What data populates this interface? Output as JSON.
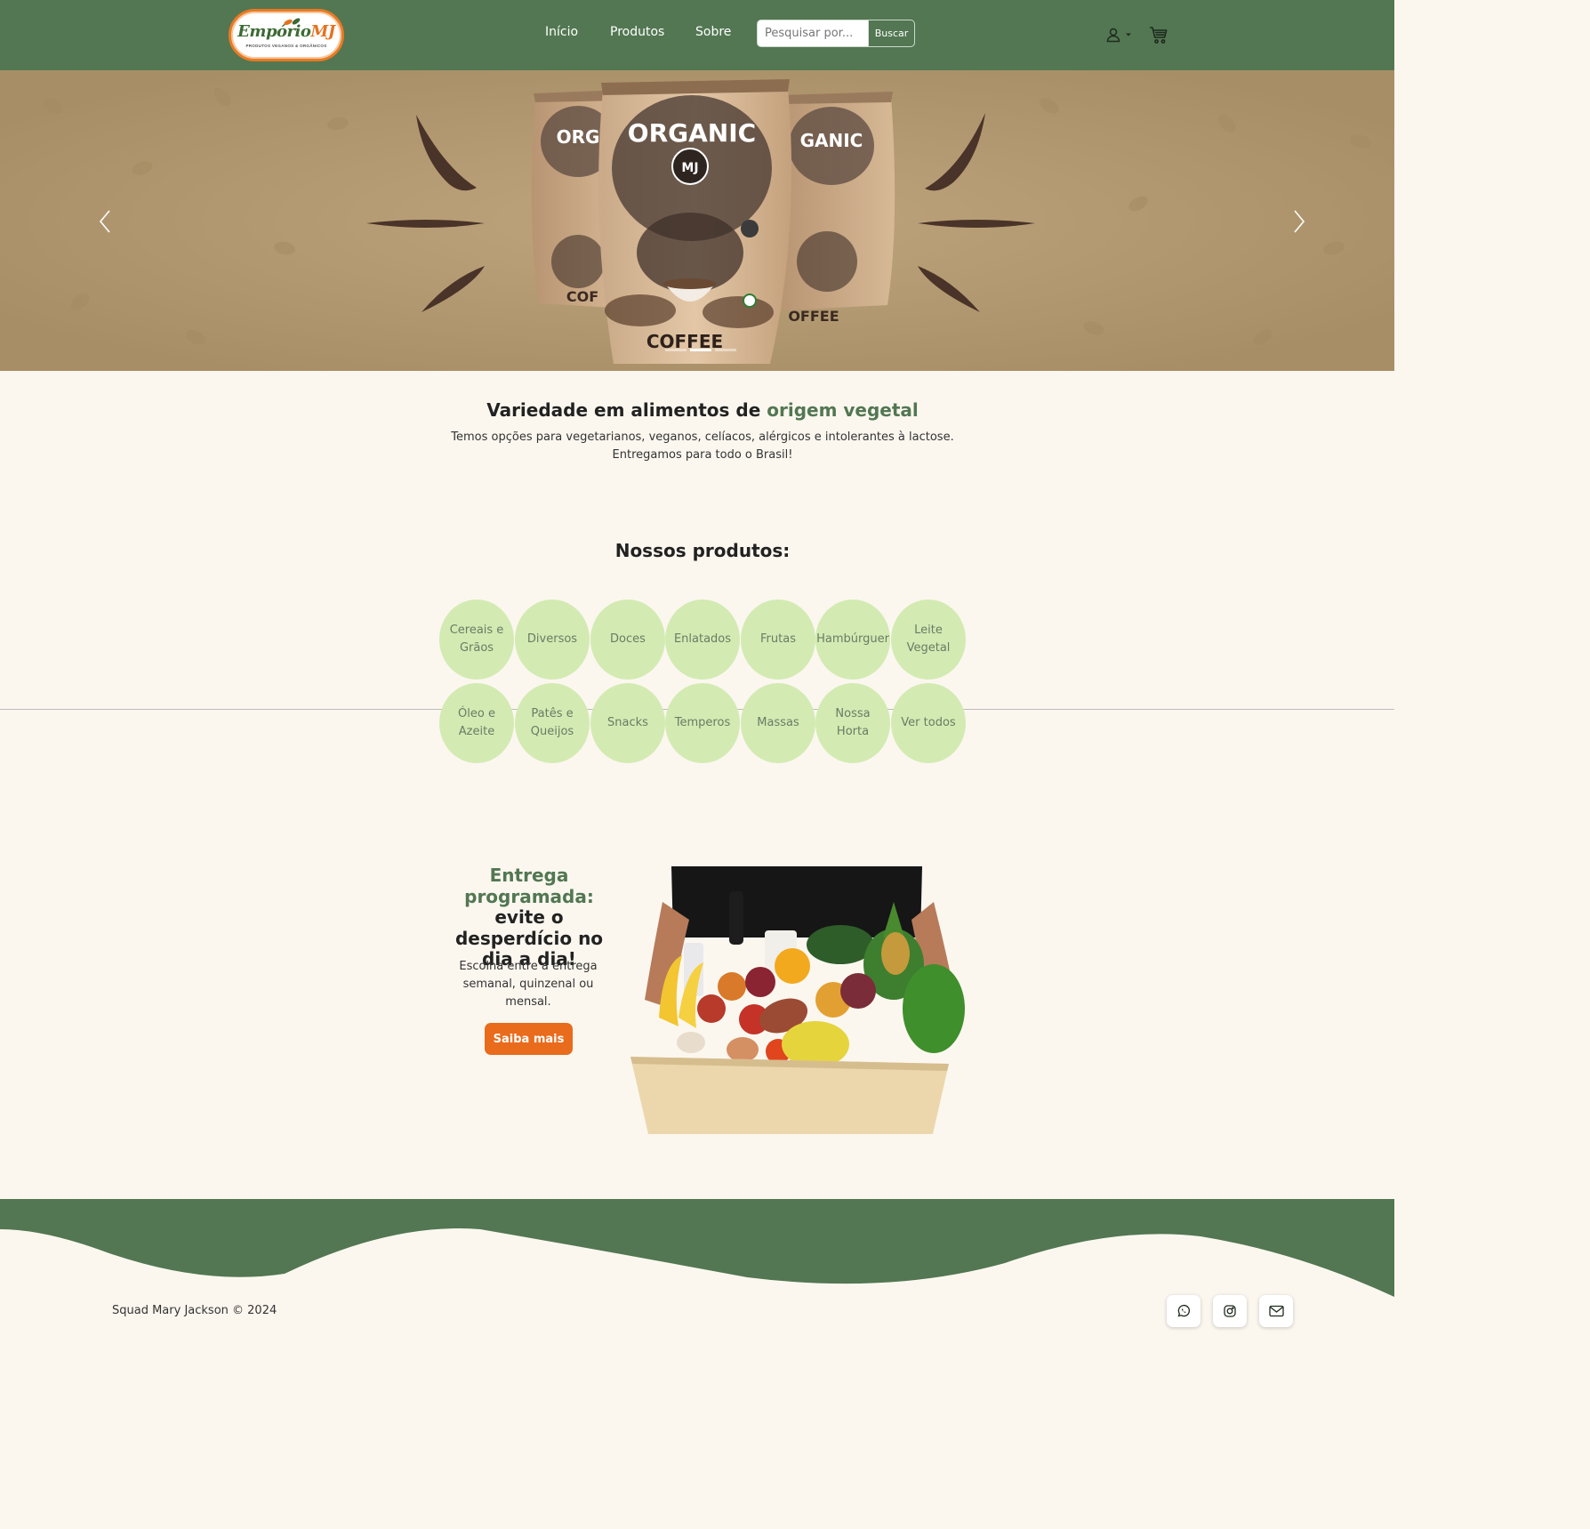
{
  "header": {
    "logo": {
      "name_part1": "Empório",
      "name_part2": "MJ",
      "tagline": "PRODUTOS VEGANOS & ORGÂNICOS"
    },
    "nav": [
      {
        "label": "Início"
      },
      {
        "label": "Produtos"
      },
      {
        "label": "Sobre"
      }
    ],
    "search": {
      "placeholder": "Pesquisar por...",
      "button_label": "Buscar"
    },
    "icons": {
      "user": "user-icon",
      "user_dropdown": "caret-down-icon",
      "cart": "cart-icon"
    }
  },
  "hero": {
    "bag_title": "ORGANIC",
    "bag_subtitle": "COFFEE",
    "bag_badge": "MJ",
    "icons": {
      "prev": "chevron-left-icon",
      "next": "chevron-right-icon"
    },
    "slide_count": 3,
    "active_slide": 2
  },
  "intro": {
    "title_main": "Variedade em alimentos de ",
    "title_accent": "origem vegetal",
    "line1": "Temos opções para vegetarianos, veganos, celíacos, alérgicos e intolerantes à lactose.",
    "line2": "Entregamos para todo o Brasil!"
  },
  "products": {
    "title": "Nossos produtos:",
    "categories": [
      {
        "label": "Cereais e Grãos"
      },
      {
        "label": "Diversos"
      },
      {
        "label": "Doces"
      },
      {
        "label": "Enlatados"
      },
      {
        "label": "Frutas"
      },
      {
        "label": "Hambúrguer"
      },
      {
        "label": "Leite Vegetal"
      },
      {
        "label": "Óleo e Azeite"
      },
      {
        "label": "Patês e Queijos"
      },
      {
        "label": "Snacks"
      },
      {
        "label": "Temperos"
      },
      {
        "label": "Massas"
      },
      {
        "label": "Nossa Horta"
      },
      {
        "label": "Ver todos"
      }
    ]
  },
  "delivery": {
    "title_accent": "Entrega programada:",
    "title_rest": " evite o desperdício no dia a dia!",
    "text": "Escolha entre a entrega semanal, quinzenal ou mensal.",
    "button_label": "Saiba mais"
  },
  "footer": {
    "copyright": "Squad Mary Jackson © 2024",
    "social": [
      {
        "icon": "whatsapp-icon"
      },
      {
        "icon": "instagram-icon"
      },
      {
        "icon": "email-icon"
      }
    ]
  },
  "colors": {
    "brand_green": "#527752",
    "accent_orange": "#e96b1c",
    "category_circle": "#d3ebb2",
    "page_background": "#fbf7ef"
  }
}
